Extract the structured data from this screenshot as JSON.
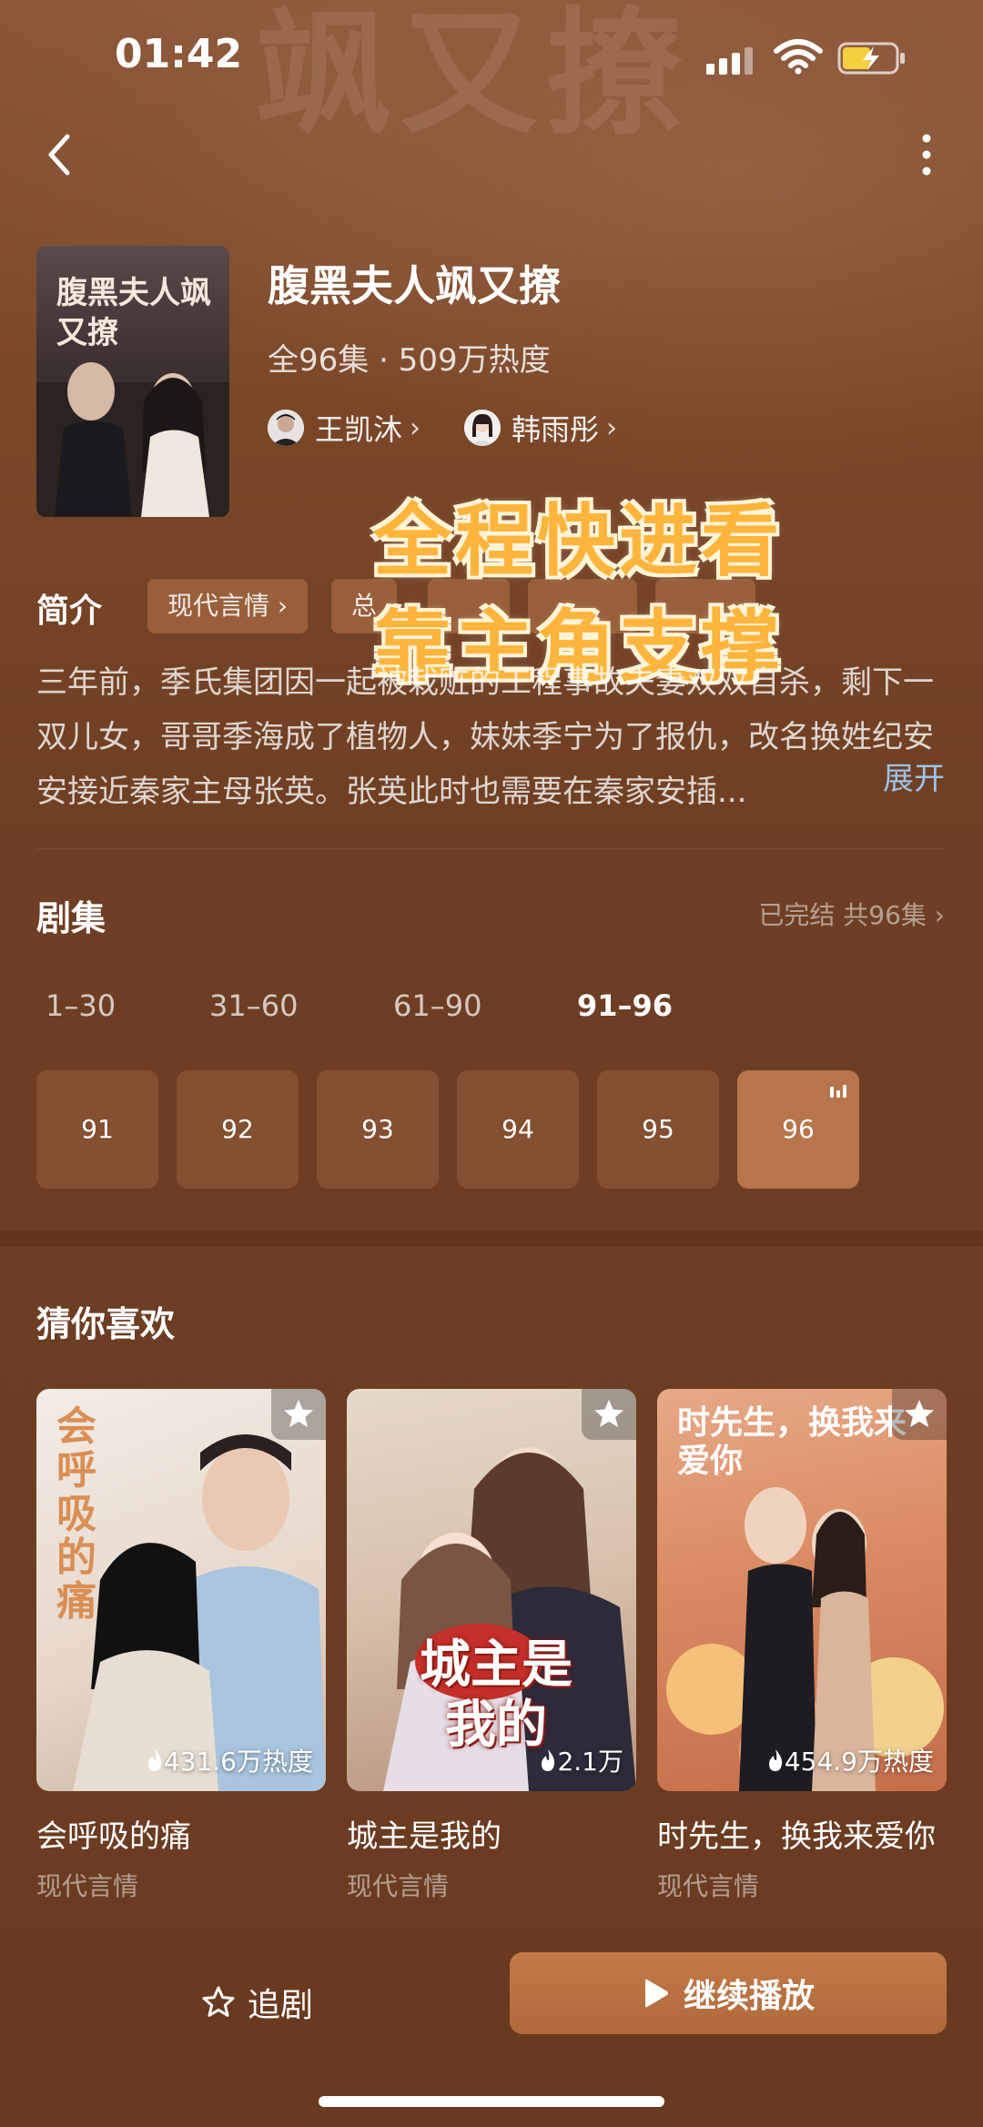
{
  "status_bar": {
    "time": "01:42"
  },
  "poster": {
    "title": "腹黑夫人飒又撩"
  },
  "show": {
    "title": "腹黑夫人飒又撩",
    "meta": "全96集 · 509万热度",
    "cast": [
      {
        "name": "王凯沐"
      },
      {
        "name": "韩雨彤"
      }
    ]
  },
  "promo": {
    "line1": "全程快进看",
    "line2": "靠主角支撑"
  },
  "intro": {
    "label": "简介",
    "tags": [
      "现代言情",
      "总"
    ],
    "synopsis": "三年前，季氏集团因一起被栽赃的工程事故夫妻双双自杀，剩下一双儿女，哥哥季海成了植物人，妹妹季宁为了报仇，改名换姓纪安安接近秦家主母张英。张英此时也需要在秦家安插...",
    "expand": "展开"
  },
  "episodes": {
    "title": "剧集",
    "status": "已完结 共96集",
    "ranges": [
      "1–30",
      "31–60",
      "61–90",
      "91–96"
    ],
    "active_range": 3,
    "buttons": [
      "91",
      "92",
      "93",
      "94",
      "95",
      "96"
    ],
    "playing": "96"
  },
  "recommend": {
    "title": "猜你喜欢",
    "items": [
      {
        "title": "会呼吸的痛",
        "genre": "现代言情",
        "heat": "431.6万热度",
        "art_text": "会呼吸的痛"
      },
      {
        "title": "城主是我的",
        "genre": "现代言情",
        "heat": "2.1万",
        "art_text": "城主是我的"
      },
      {
        "title": "时先生，换我来爱你",
        "genre": "现代言情",
        "heat": "454.9万热度",
        "art_text": "时先生，换我来爱你"
      }
    ]
  },
  "bottom": {
    "follow": "追剧",
    "play": "继续播放"
  },
  "colors": {
    "background": "#6b3d22",
    "accent": "#b8744a",
    "link": "#9cc3ea",
    "promo": "#ffb43c"
  }
}
